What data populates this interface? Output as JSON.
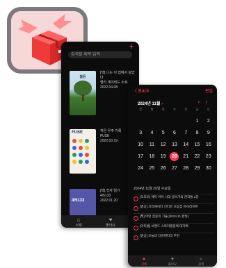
{
  "colors": {
    "accent": "#ff3b4e",
    "background": "#0c0c0c"
  },
  "library": {
    "search_placeholder": "검색할 제목 입력",
    "books": [
      {
        "cover_title": "월든",
        "meta": "[책] 나는 이 집에서 살았다\n헨리 데이비드 소로\n2022.04.08"
      },
      {
        "cover_title": "FUSE",
        "meta": "작은 우주 기록\nFUSE\n2022.03.19"
      },
      {
        "cover_title": "4/5133",
        "meta": "[책] 숫자 읽기\n4/5133\n2022.01.20"
      }
    ],
    "tabs": [
      "서재",
      "좋아요"
    ]
  },
  "calendar": {
    "back_label": "〈 Back",
    "right_label": "편집",
    "month_label": "2024년 11월",
    "weekdays": [
      "일",
      "월",
      "화",
      "수",
      "목",
      "금",
      "토"
    ],
    "weeks": [
      [
        "",
        "",
        "",
        "",
        "",
        "1",
        "2"
      ],
      [
        "3",
        "4",
        "5",
        "6",
        "7",
        "8",
        "9"
      ],
      [
        "10",
        "11",
        "12",
        "13",
        "14",
        "15",
        "16"
      ],
      [
        "17",
        "18",
        "19",
        "20",
        "21",
        "22",
        "23"
      ],
      [
        "24",
        "25",
        "26",
        "27",
        "28",
        "29",
        "30"
      ]
    ],
    "today": "20",
    "events_header": "2024년 11월 20일 수요일",
    "events": [
      "[오디오] 에이 아이 시대 글쓰기의 감각들 2장",
      "[영상] 크리에이터 인터뷰 모음집 하이라이트",
      "[책] 어떤 집중의 기술 [2024.11 완독]",
      "[아티클] 브랜드 스토리텔링에 대하여",
      "[영상] 오늘의 다큐멘터리 추천"
    ],
    "tabs": [
      "기록",
      "좋아요",
      "검색"
    ]
  }
}
